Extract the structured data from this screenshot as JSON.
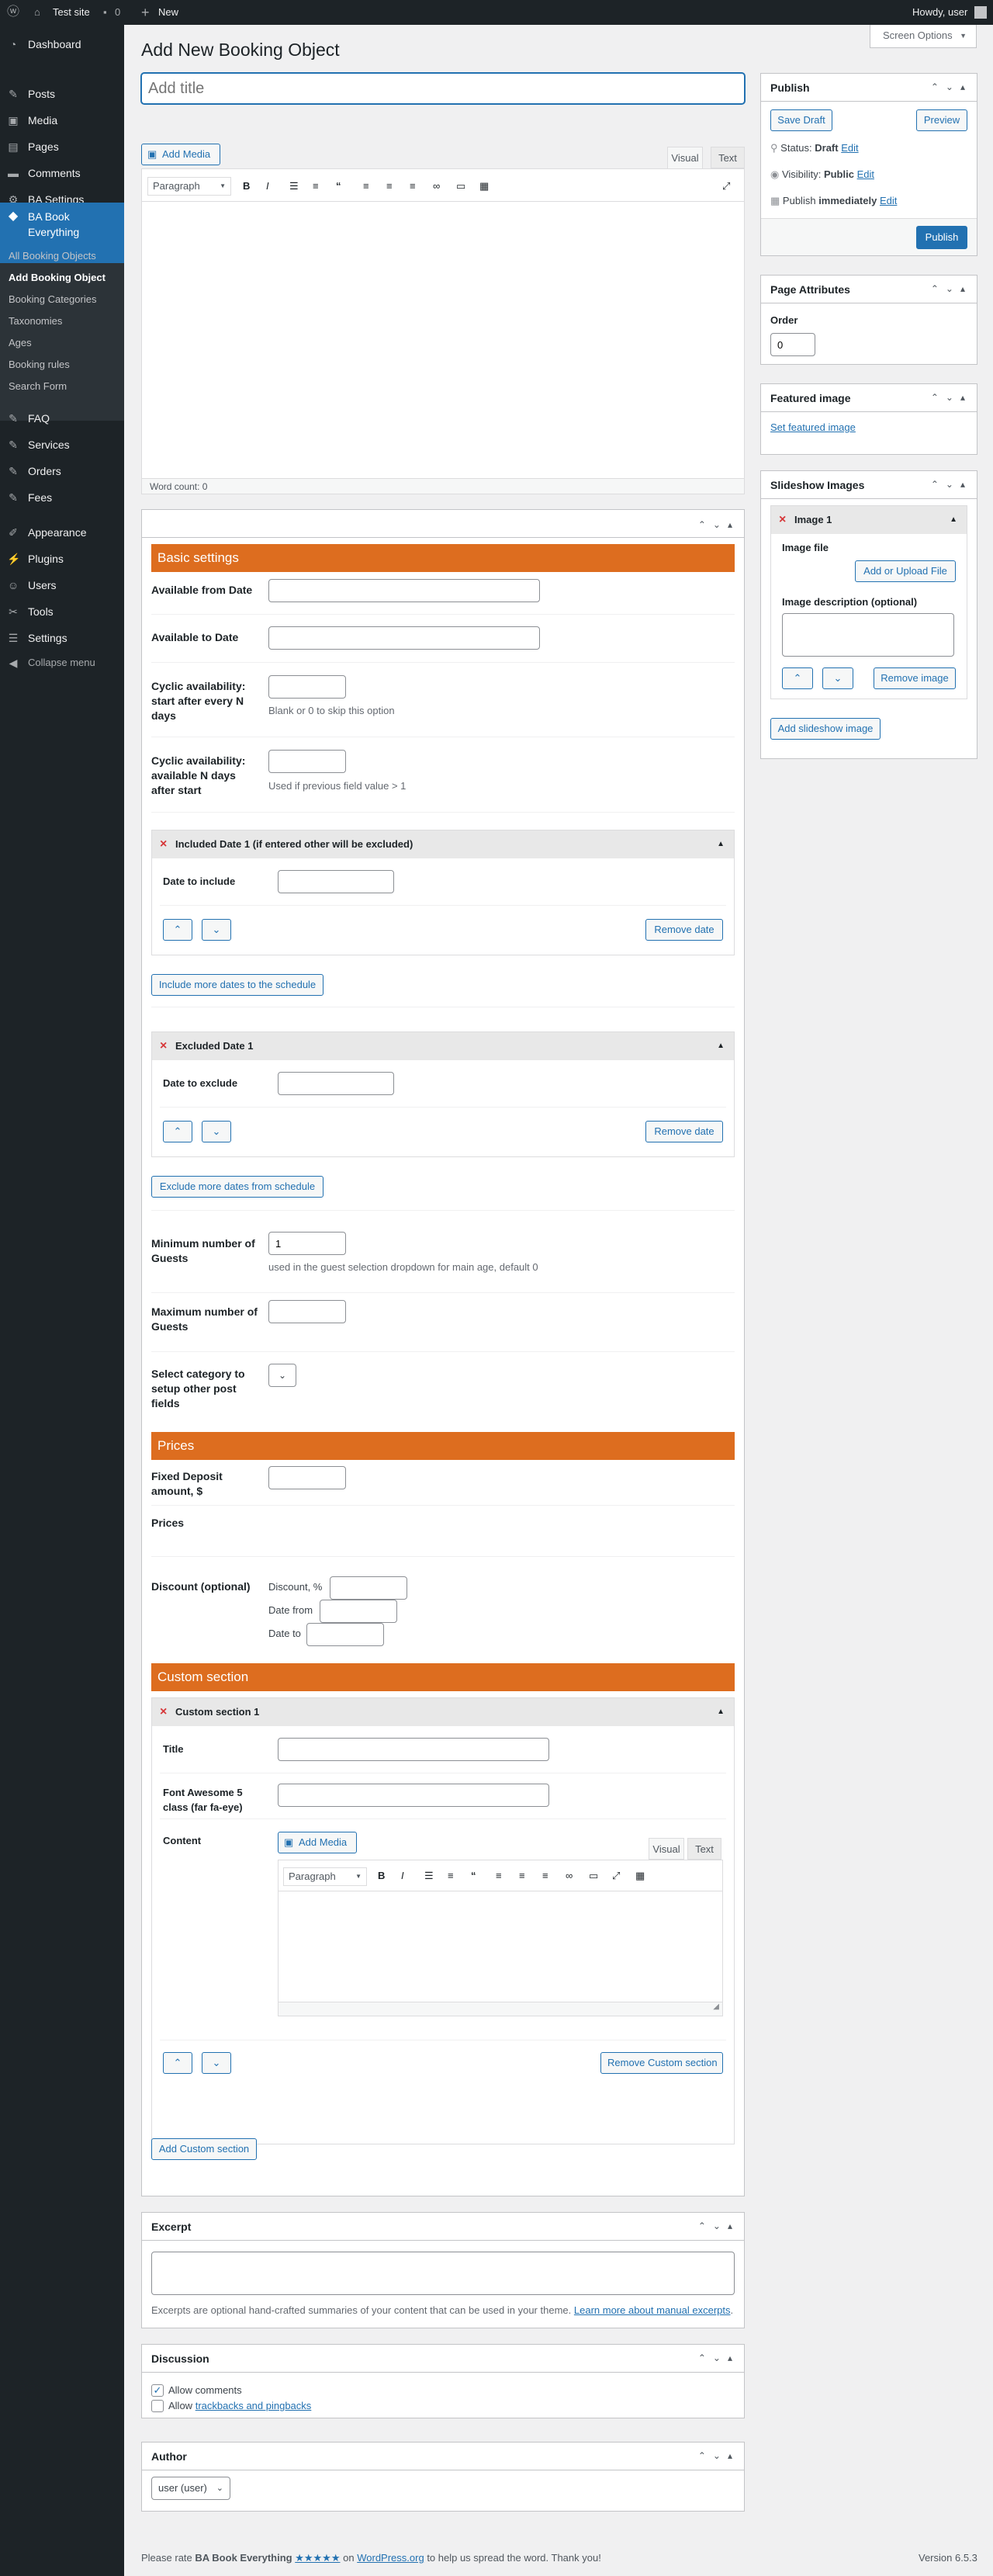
{
  "admin_bar": {
    "site": "Test site",
    "comments": "0",
    "new": "New",
    "howdy": "Howdy, user"
  },
  "sidebar": {
    "items": [
      {
        "label": "Dashboard",
        "icon": "dashboard-icon"
      },
      {
        "label": "Posts",
        "icon": "pin-icon"
      },
      {
        "label": "Media",
        "icon": "media-icon"
      },
      {
        "label": "Pages",
        "icon": "page-icon"
      },
      {
        "label": "Comments",
        "icon": "comment-icon"
      },
      {
        "label": "BA Settings",
        "icon": "gear-icon"
      },
      {
        "label": "BA Book Everything",
        "icon": "diamond-icon"
      },
      {
        "label": "FAQ",
        "icon": "pin-icon"
      },
      {
        "label": "Services",
        "icon": "pin-icon"
      },
      {
        "label": "Orders",
        "icon": "pin-icon"
      },
      {
        "label": "Fees",
        "icon": "pin-icon"
      },
      {
        "label": "Appearance",
        "icon": "brush-icon"
      },
      {
        "label": "Plugins",
        "icon": "plugin-icon"
      },
      {
        "label": "Users",
        "icon": "user-icon"
      },
      {
        "label": "Tools",
        "icon": "wrench-icon"
      },
      {
        "label": "Settings",
        "icon": "settings-icon"
      },
      {
        "label": "Collapse menu",
        "icon": "collapse-icon"
      }
    ],
    "sub_items": [
      "All Booking Objects",
      "Add Booking Object",
      "Booking Categories",
      "Taxonomies",
      "Ages",
      "Booking rules",
      "Search Form"
    ]
  },
  "screen_options": "Screen Options",
  "page": {
    "title": "Add New Booking Object",
    "title_placeholder": "Add title"
  },
  "editor": {
    "add_media": "Add Media",
    "tab_visual": "Visual",
    "tab_text": "Text",
    "paragraph": "Paragraph",
    "word_count": "Word count: 0"
  },
  "basic": {
    "section_title": "Basic settings",
    "available_from": "Available from Date",
    "available_to": "Available to Date",
    "cyclic_start": "Cyclic availability: start after every N days",
    "cyclic_start_hint": "Blank or 0 to skip this option",
    "cyclic_days": "Cyclic availability: available N days after start",
    "cyclic_days_hint": "Used if previous field value > 1",
    "included_title": "Included Date 1 (if entered other will be excluded)",
    "date_to_include": "Date to include",
    "remove_date": "Remove date",
    "include_more": "Include more dates to the schedule",
    "excluded_title": "Excluded Date 1",
    "date_to_exclude": "Date to exclude",
    "exclude_more": "Exclude more dates from schedule",
    "min_guests": "Minimum number of Guests",
    "min_guests_value": "1",
    "min_guests_hint": "used in the guest selection dropdown for main age, default 0",
    "max_guests": "Maximum number of Guests",
    "select_category": "Select category to setup other post fields"
  },
  "prices": {
    "section_title": "Prices",
    "fixed_deposit": "Fixed Deposit amount, $",
    "prices": "Prices",
    "discount": "Discount (optional)",
    "discount_pct": "Discount, %",
    "date_from": "Date from",
    "date_to": "Date to"
  },
  "custom": {
    "section_title": "Custom section",
    "group_title": "Custom section 1",
    "title_label": "Title",
    "fa_label": "Font Awesome 5 class (far fa-eye)",
    "content_label": "Content",
    "remove": "Remove Custom section",
    "add": "Add Custom section"
  },
  "publish": {
    "title": "Publish",
    "save_draft": "Save Draft",
    "preview": "Preview",
    "status_label": "Status:",
    "status_value": "Draft",
    "visibility_label": "Visibility:",
    "visibility_value": "Public",
    "publish_label": "Publish",
    "publish_value": "immediately",
    "edit": "Edit",
    "publish_button": "Publish"
  },
  "page_attributes": {
    "title": "Page Attributes",
    "order_label": "Order",
    "order_value": "0"
  },
  "featured": {
    "title": "Featured image",
    "link": "Set featured image"
  },
  "slideshow": {
    "title": "Slideshow Images",
    "image_title": "Image 1",
    "image_file": "Image file",
    "upload": "Add or Upload File",
    "desc": "Image description (optional)",
    "remove": "Remove image",
    "add": "Add slideshow image"
  },
  "excerpt": {
    "title": "Excerpt",
    "hint": "Excerpts are optional hand-crafted summaries of your content that can be used in your theme.",
    "link": "Learn more about manual excerpts"
  },
  "discussion": {
    "title": "Discussion",
    "allow_comments": "Allow comments",
    "allow_label": "Allow",
    "trackbacks": "trackbacks and pingbacks"
  },
  "author": {
    "title": "Author",
    "value": "user (user)"
  },
  "footer": {
    "please": "Please rate",
    "plugin": "BA Book Everything",
    "stars": "★★★★★",
    "on": "on",
    "wp": "WordPress.org",
    "rest": "to help us spread the word. Thank you!",
    "version": "Version 6.5.3"
  }
}
